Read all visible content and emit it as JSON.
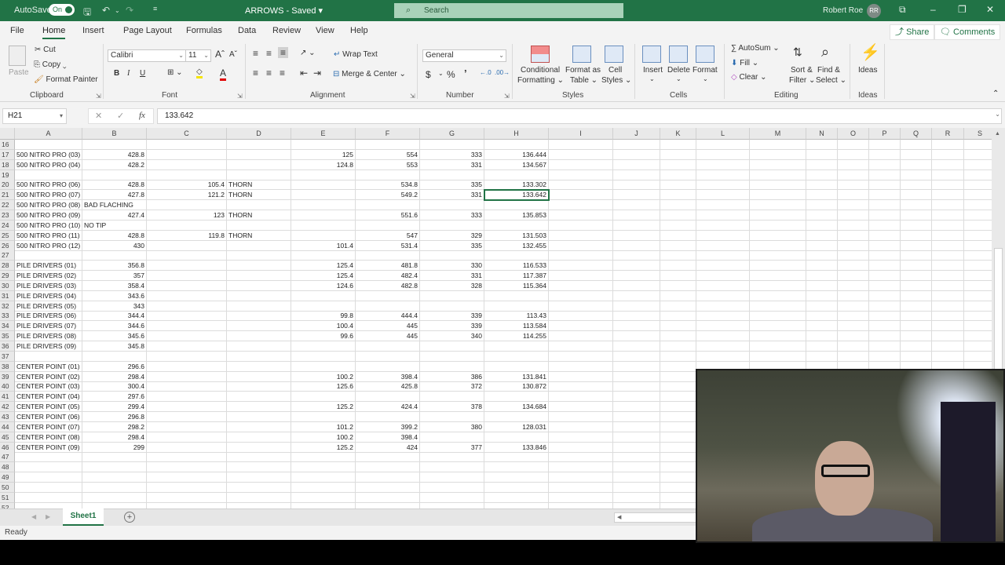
{
  "titlebar": {
    "autosave_label": "AutoSave",
    "autosave_state": "On",
    "doc_title": "ARROWS - Saved",
    "doc_title_caret": "▾",
    "search_placeholder": "Search",
    "user_name": "Robert Roe",
    "user_initials": "RR"
  },
  "menu": {
    "tabs": [
      "File",
      "Home",
      "Insert",
      "Page Layout",
      "Formulas",
      "Data",
      "Review",
      "View",
      "Help"
    ],
    "active": "Home",
    "share_label": "Share",
    "comments_label": "Comments"
  },
  "ribbon": {
    "clipboard": {
      "paste": "Paste",
      "cut": "Cut",
      "copy": "Copy",
      "format_painter": "Format Painter",
      "label": "Clipboard"
    },
    "font": {
      "name": "Calibri",
      "size": "11",
      "bold": "B",
      "italic": "I",
      "underline": "U",
      "label": "Font"
    },
    "alignment": {
      "wrap_text": "Wrap Text",
      "merge_center": "Merge & Center",
      "label": "Alignment"
    },
    "number": {
      "format": "General",
      "currency": "$",
      "percent": "%",
      "comma": "9",
      "label": "Number"
    },
    "styles": {
      "conditional": "Conditional",
      "conditional2": "Formatting",
      "format_as": "Format as",
      "format_as2": "Table",
      "cell": "Cell",
      "cell2": "Styles",
      "label": "Styles"
    },
    "cells": {
      "insert": "Insert",
      "delete": "Delete",
      "format": "Format",
      "label": "Cells"
    },
    "editing": {
      "autosum": "AutoSum",
      "fill": "Fill",
      "clear": "Clear",
      "sort": "Sort &",
      "sort2": "Filter",
      "find": "Find &",
      "find2": "Select",
      "label": "Editing"
    },
    "ideas": {
      "ideas": "Ideas",
      "label": "Ideas"
    }
  },
  "formula_bar": {
    "name_box": "H21",
    "formula": "133.642",
    "fx": "fx"
  },
  "columns": [
    "A",
    "B",
    "C",
    "D",
    "E",
    "F",
    "G",
    "H",
    "I",
    "J",
    "K",
    "L",
    "M",
    "N",
    "O",
    "P",
    "Q",
    "R",
    "S"
  ],
  "rows": [
    {
      "n": "16",
      "A": "",
      "B": "",
      "C": "",
      "D": "",
      "E": "",
      "F": "",
      "G": "",
      "H": ""
    },
    {
      "n": "17",
      "A": "500 NITRO PRO (03)",
      "B": "428.8",
      "C": "",
      "D": "",
      "E": "125",
      "F": "554",
      "G": "333",
      "H": "136.444"
    },
    {
      "n": "18",
      "A": "500 NITRO PRO (04)",
      "B": "428.2",
      "C": "",
      "D": "",
      "E": "124.8",
      "F": "553",
      "G": "331",
      "H": "134.567"
    },
    {
      "n": "19",
      "A": "",
      "B": "",
      "C": "",
      "D": "",
      "E": "",
      "F": "",
      "G": "",
      "H": ""
    },
    {
      "n": "20",
      "A": "500 NITRO PRO (06)",
      "B": "428.8",
      "C": "105.4",
      "D": "THORN",
      "E": "",
      "F": "534.8",
      "G": "335",
      "H": "133.302"
    },
    {
      "n": "21",
      "A": "500 NITRO PRO (07)",
      "B": "427.8",
      "C": "121.2",
      "D": "THORN",
      "E": "",
      "F": "549.2",
      "G": "331",
      "H": "133.642"
    },
    {
      "n": "22",
      "A": "500 NITRO PRO (08)",
      "B": "BAD FLACHING",
      "C": "",
      "D": "",
      "E": "",
      "F": "",
      "G": "",
      "H": ""
    },
    {
      "n": "23",
      "A": "500 NITRO PRO (09)",
      "B": "427.4",
      "C": "123",
      "D": "THORN",
      "E": "",
      "F": "551.6",
      "G": "333",
      "H": "135.853"
    },
    {
      "n": "24",
      "A": "500 NITRO PRO (10)",
      "B": "NO TIP",
      "C": "",
      "D": "",
      "E": "",
      "F": "",
      "G": "",
      "H": ""
    },
    {
      "n": "25",
      "A": "500 NITRO PRO (11)",
      "B": "428.8",
      "C": "119.8",
      "D": "THORN",
      "E": "",
      "F": "547",
      "G": "329",
      "H": "131.503"
    },
    {
      "n": "26",
      "A": "500 NITRO PRO (12)",
      "B": "430",
      "C": "",
      "D": "",
      "E": "101.4",
      "F": "531.4",
      "G": "335",
      "H": "132.455"
    },
    {
      "n": "27",
      "A": "",
      "B": "",
      "C": "",
      "D": "",
      "E": "",
      "F": "",
      "G": "",
      "H": ""
    },
    {
      "n": "28",
      "A": "PILE DRIVERS (01)",
      "B": "356.8",
      "C": "",
      "D": "",
      "E": "125.4",
      "F": "481.8",
      "G": "330",
      "H": "116.533"
    },
    {
      "n": "29",
      "A": "PILE DRIVERS (02)",
      "B": "357",
      "C": "",
      "D": "",
      "E": "125.4",
      "F": "482.4",
      "G": "331",
      "H": "117.387"
    },
    {
      "n": "30",
      "A": "PILE DRIVERS (03)",
      "B": "358.4",
      "C": "",
      "D": "",
      "E": "124.6",
      "F": "482.8",
      "G": "328",
      "H": "115.364"
    },
    {
      "n": "31",
      "A": "PILE DRIVERS (04)",
      "B": "343.6",
      "C": "",
      "D": "",
      "E": "",
      "F": "",
      "G": "",
      "H": ""
    },
    {
      "n": "32",
      "A": "PILE DRIVERS (05)",
      "B": "343",
      "C": "",
      "D": "",
      "E": "",
      "F": "",
      "G": "",
      "H": ""
    },
    {
      "n": "33",
      "A": "PILE DRIVERS (06)",
      "B": "344.4",
      "C": "",
      "D": "",
      "E": "99.8",
      "F": "444.4",
      "G": "339",
      "H": "113.43"
    },
    {
      "n": "34",
      "A": "PILE DRIVERS (07)",
      "B": "344.6",
      "C": "",
      "D": "",
      "E": "100.4",
      "F": "445",
      "G": "339",
      "H": "113.584"
    },
    {
      "n": "35",
      "A": "PILE DRIVERS (08)",
      "B": "345.6",
      "C": "",
      "D": "",
      "E": "99.6",
      "F": "445",
      "G": "340",
      "H": "114.255"
    },
    {
      "n": "36",
      "A": "PILE DRIVERS (09)",
      "B": "345.8",
      "C": "",
      "D": "",
      "E": "",
      "F": "",
      "G": "",
      "H": ""
    },
    {
      "n": "37",
      "A": "",
      "B": "",
      "C": "",
      "D": "",
      "E": "",
      "F": "",
      "G": "",
      "H": ""
    },
    {
      "n": "38",
      "A": "CENTER POINT (01)",
      "B": "296.6",
      "C": "",
      "D": "",
      "E": "",
      "F": "",
      "G": "",
      "H": ""
    },
    {
      "n": "39",
      "A": "CENTER POINT (02)",
      "B": "298.4",
      "C": "",
      "D": "",
      "E": "100.2",
      "F": "398.4",
      "G": "386",
      "H": "131.841"
    },
    {
      "n": "40",
      "A": "CENTER POINT (03)",
      "B": "300.4",
      "C": "",
      "D": "",
      "E": "125.6",
      "F": "425.8",
      "G": "372",
      "H": "130.872"
    },
    {
      "n": "41",
      "A": "CENTER POINT (04)",
      "B": "297.6",
      "C": "",
      "D": "",
      "E": "",
      "F": "",
      "G": "",
      "H": ""
    },
    {
      "n": "42",
      "A": "CENTER POINT (05)",
      "B": "299.4",
      "C": "",
      "D": "",
      "E": "125.2",
      "F": "424.4",
      "G": "378",
      "H": "134.684"
    },
    {
      "n": "43",
      "A": "CENTER POINT (06)",
      "B": "296.8",
      "C": "",
      "D": "",
      "E": "",
      "F": "",
      "G": "",
      "H": ""
    },
    {
      "n": "44",
      "A": "CENTER POINT (07)",
      "B": "298.2",
      "C": "",
      "D": "",
      "E": "101.2",
      "F": "399.2",
      "G": "380",
      "H": "128.031"
    },
    {
      "n": "45",
      "A": "CENTER POINT (08)",
      "B": "298.4",
      "C": "",
      "D": "",
      "E": "100.2",
      "F": "398.4",
      "G": "",
      "H": ""
    },
    {
      "n": "46",
      "A": "CENTER POINT (09)",
      "B": "299",
      "C": "",
      "D": "",
      "E": "125.2",
      "F": "424",
      "G": "377",
      "H": "133.846"
    },
    {
      "n": "47",
      "A": "",
      "B": "",
      "C": "",
      "D": "",
      "E": "",
      "F": "",
      "G": "",
      "H": ""
    },
    {
      "n": "48",
      "A": "",
      "B": "",
      "C": "",
      "D": "",
      "E": "",
      "F": "",
      "G": "",
      "H": ""
    },
    {
      "n": "49",
      "A": "",
      "B": "",
      "C": "",
      "D": "",
      "E": "",
      "F": "",
      "G": "",
      "H": ""
    },
    {
      "n": "50",
      "A": "",
      "B": "",
      "C": "",
      "D": "",
      "E": "",
      "F": "",
      "G": "",
      "H": ""
    },
    {
      "n": "51",
      "A": "",
      "B": "",
      "C": "",
      "D": "",
      "E": "",
      "F": "",
      "G": "",
      "H": ""
    },
    {
      "n": "52",
      "A": "",
      "B": "",
      "C": "",
      "D": "",
      "E": "",
      "F": "",
      "G": "",
      "H": ""
    }
  ],
  "selected_cell": "H21",
  "sheets": {
    "tabs": [
      "Sheet1"
    ],
    "active": "Sheet1",
    "add": "+"
  },
  "status": {
    "text": "Ready"
  },
  "colors": {
    "brand": "#217346",
    "search": "#a9d2b9"
  }
}
